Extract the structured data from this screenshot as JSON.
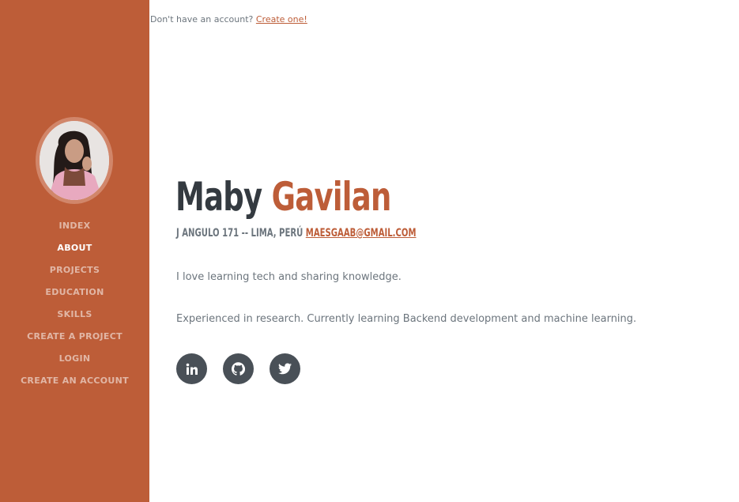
{
  "account_prompt": {
    "text": "Don't have an account?",
    "link": "Create one!"
  },
  "sidebar": {
    "brand_color": "#bd5d38",
    "nav": [
      {
        "label": "Index",
        "active": false
      },
      {
        "label": "About",
        "active": true
      },
      {
        "label": "Projects",
        "active": false
      },
      {
        "label": "Education",
        "active": false
      },
      {
        "label": "Skills",
        "active": false
      },
      {
        "label": "Create a project",
        "active": false
      },
      {
        "label": "Login",
        "active": false
      },
      {
        "label": "Create an account",
        "active": false
      }
    ]
  },
  "profile": {
    "first_name": "Maby",
    "last_name": "Gavilan",
    "address": "J Angulo 171 -- Lima, Perú",
    "email": "maesgaab@gmail.com",
    "lead_1": "I love learning tech and sharing knowledge.",
    "lead_2": "Experienced in research. Currently learning Backend development and machine learning."
  },
  "social": [
    {
      "icon": "linkedin-icon"
    },
    {
      "icon": "github-icon"
    },
    {
      "icon": "twitter-icon"
    }
  ]
}
